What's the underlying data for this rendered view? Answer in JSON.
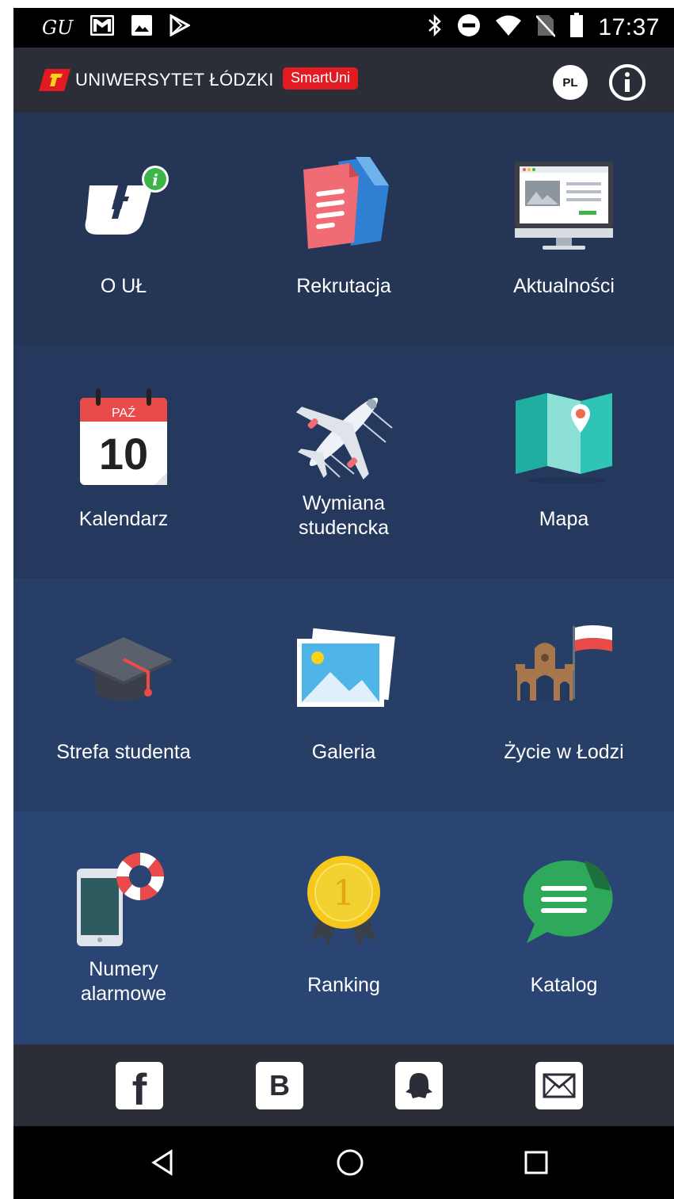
{
  "status_bar": {
    "left_text": "GU",
    "time": "17:37",
    "icons": [
      "gmail-icon",
      "image-icon",
      "play-store-icon",
      "bluetooth-icon",
      "do-not-disturb-icon",
      "wifi-icon",
      "no-sim-icon",
      "battery-icon"
    ]
  },
  "header": {
    "university_name": "UNIWERSYTET ŁÓDZKI",
    "badge": "SmartUni",
    "language": "PL",
    "colors": {
      "header_bg": "#2b2d37",
      "badge": "#e21b23"
    }
  },
  "tiles": [
    {
      "label": "O UŁ",
      "icon": "ul-logo-icon"
    },
    {
      "label": "Rekrutacja",
      "icon": "documents-icon"
    },
    {
      "label": "Aktualności",
      "icon": "monitor-news-icon"
    },
    {
      "label": "Kalendarz",
      "icon": "calendar-icon",
      "icon_month": "PAŹ",
      "icon_day": "10"
    },
    {
      "label": "Wymiana studencka",
      "icon": "airplane-icon"
    },
    {
      "label": "Mapa",
      "icon": "map-icon"
    },
    {
      "label": "Strefa studenta",
      "icon": "graduation-cap-icon"
    },
    {
      "label": "Galeria",
      "icon": "gallery-icon"
    },
    {
      "label": "Życie w Łodzi",
      "icon": "city-gate-flag-icon"
    },
    {
      "label": "Numery alarmowe",
      "icon": "phone-lifebuoy-icon"
    },
    {
      "label": "Ranking",
      "icon": "medal-icon",
      "icon_text": "1"
    },
    {
      "label": "Katalog",
      "icon": "chat-bubble-icon"
    }
  ],
  "row_colors": [
    "#243556",
    "#25395e",
    "#273e67",
    "#2a4574"
  ],
  "social": [
    {
      "name": "facebook",
      "glyph": "f"
    },
    {
      "name": "vk",
      "glyph": "B"
    },
    {
      "name": "snapchat",
      "glyph": ""
    },
    {
      "name": "email",
      "glyph": ""
    }
  ],
  "nav": [
    "back",
    "home",
    "recents"
  ]
}
